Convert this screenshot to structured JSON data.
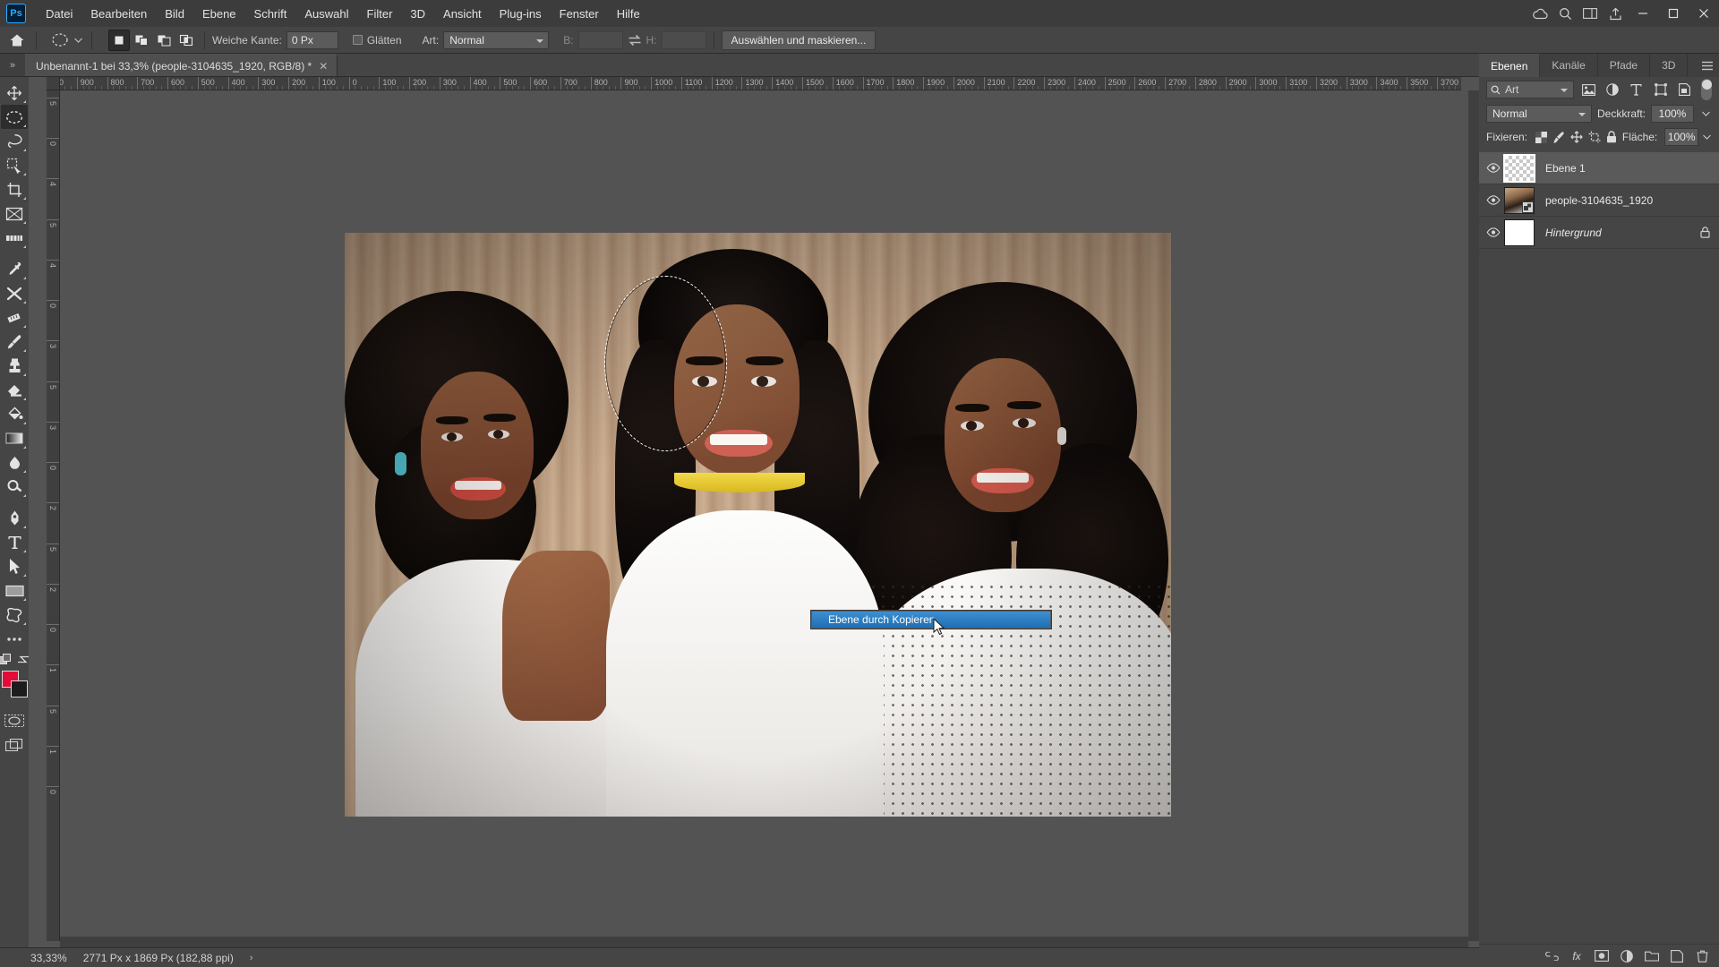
{
  "app": {
    "name": "Adobe Photoshop",
    "logo_text": "Ps"
  },
  "menubar": {
    "items": [
      "Datei",
      "Bearbeiten",
      "Bild",
      "Ebene",
      "Schrift",
      "Auswahl",
      "Filter",
      "3D",
      "Ansicht",
      "Plug-ins",
      "Fenster",
      "Hilfe"
    ],
    "right_icons": [
      "cloud-icon",
      "search-icon",
      "workspace-icon",
      "share-icon"
    ],
    "window_controls": [
      "minimize",
      "maximize",
      "close"
    ]
  },
  "options_bar": {
    "home_icon": "home-icon",
    "tool_preset_icon": "elliptical-marquee-icon",
    "selection_modes": [
      "new-selection",
      "add-to-selection",
      "subtract-from-selection",
      "intersect-with-selection"
    ],
    "feather_label": "Weiche Kante:",
    "feather_value": "0 Px",
    "antialias_label": "Glätten",
    "antialias_checked": false,
    "style_label": "Art:",
    "style_value": "Normal",
    "width_label": "B:",
    "width_value": "",
    "swap_icon": "swap-width-height-icon",
    "height_label": "H:",
    "height_value": "",
    "select_and_mask_button": "Auswählen und maskieren..."
  },
  "tab_bar": {
    "collapse_icon": "chevron-double-right-icon",
    "document_title": "Unbenannt-1 bei 33,3% (people-3104635_1920, RGB/8) *",
    "close_icon": "close-icon"
  },
  "rulers": {
    "horizontal_labels": [
      "000",
      "900",
      "800",
      "700",
      "600",
      "500",
      "400",
      "300",
      "200",
      "100",
      "0",
      "100",
      "200",
      "300",
      "400",
      "500",
      "600",
      "700",
      "800",
      "900",
      "1000",
      "1100",
      "1200",
      "1300",
      "1400",
      "1500",
      "1600",
      "1700",
      "1800",
      "1900",
      "2000",
      "2100",
      "2200",
      "2300",
      "2400",
      "2500",
      "2600",
      "2700",
      "2800",
      "2900",
      "3000",
      "3100",
      "3200",
      "3300",
      "3400",
      "3500",
      "3700"
    ],
    "vertical_labels": [
      "5",
      "0",
      "4",
      "5",
      "4",
      "0",
      "3",
      "5",
      "3",
      "0",
      "2",
      "5",
      "2",
      "0",
      "1",
      "5",
      "1",
      "0"
    ]
  },
  "toolbar": {
    "tools": [
      {
        "name": "move-tool",
        "active": false
      },
      {
        "name": "elliptical-marquee-tool",
        "active": true
      },
      {
        "name": "lasso-tool",
        "active": false
      },
      {
        "name": "quick-selection-tool",
        "active": false
      },
      {
        "name": "crop-tool",
        "active": false
      },
      {
        "name": "frame-tool",
        "active": false
      },
      {
        "name": "slice-tool",
        "active": false
      },
      {
        "name": "eyedropper-tool",
        "active": false
      },
      {
        "name": "healing-brush-tool",
        "active": false
      },
      {
        "name": "patch-tool",
        "active": false
      },
      {
        "name": "brush-tool",
        "active": false
      },
      {
        "name": "clone-stamp-tool",
        "active": false
      },
      {
        "name": "eraser-tool",
        "active": false
      },
      {
        "name": "paint-bucket-tool",
        "active": false
      },
      {
        "name": "gradient-tool",
        "active": false
      },
      {
        "name": "blur-tool",
        "active": false
      },
      {
        "name": "dodge-tool",
        "active": false
      },
      {
        "name": "pen-tool",
        "active": false
      },
      {
        "name": "type-tool",
        "active": false
      },
      {
        "name": "path-selection-tool",
        "active": false
      },
      {
        "name": "rectangle-tool",
        "active": false
      },
      {
        "name": "custom-shape-tool",
        "active": false
      },
      {
        "name": "more-tools-icon",
        "active": false
      },
      {
        "name": "edit-toolbar-icon",
        "active": false
      },
      {
        "name": "swap-colors-icon",
        "active": false
      }
    ],
    "foreground_color": "#e30b38",
    "background_color": "#1d1d1d",
    "quick_mask_icon": "quick-mask-icon",
    "screen_mode_icon": "screen-mode-icon"
  },
  "context_menu": {
    "items": [
      {
        "label": "Ebene durch Kopieren",
        "highlighted": true
      }
    ],
    "highlight_color": "#2a7fc4",
    "cursor_icon": "mouse-cursor-icon"
  },
  "layers_panel": {
    "tabs": [
      {
        "label": "Ebenen",
        "active": true
      },
      {
        "label": "Kanäle",
        "active": false
      },
      {
        "label": "Pfade",
        "active": false
      },
      {
        "label": "3D",
        "active": false
      }
    ],
    "panel_menu_icon": "panel-menu-icon",
    "filter": {
      "search_icon": "search-icon",
      "kind_label": "Art",
      "icons": [
        "pixel-layers-filter-icon",
        "adjustment-layers-filter-icon",
        "type-layers-filter-icon",
        "shape-layers-filter-icon",
        "smart-object-filter-icon"
      ],
      "toggle_name": "filter-enable-toggle"
    },
    "blend_mode": "Normal",
    "opacity_label": "Deckkraft:",
    "opacity_value": "100%",
    "lock_label": "Fixieren:",
    "lock_icons": [
      "lock-transparent-pixels-icon",
      "lock-image-pixels-icon",
      "lock-position-icon",
      "lock-artboard-nesting-icon",
      "lock-all-icon"
    ],
    "fill_label": "Fläche:",
    "fill_value": "100%",
    "layers": [
      {
        "name": "Ebene 1",
        "visible": true,
        "selected": true,
        "locked": false,
        "italic": false,
        "thumb": "transparent"
      },
      {
        "name": "people-3104635_1920",
        "visible": true,
        "selected": false,
        "locked": false,
        "italic": false,
        "thumb": "photo"
      },
      {
        "name": "Hintergrund",
        "visible": true,
        "selected": false,
        "locked": true,
        "italic": true,
        "thumb": "white"
      }
    ],
    "footer_icons": [
      "link-layers-icon",
      "layer-style-icon",
      "layer-mask-icon",
      "adjustment-layer-icon",
      "new-group-icon",
      "new-layer-icon",
      "delete-layer-icon"
    ]
  },
  "status_bar": {
    "zoom": "33,33%",
    "document_size": "2771 Px x 1869 Px (182,88 ppi)",
    "expand_icon": "chevron-right-icon"
  }
}
